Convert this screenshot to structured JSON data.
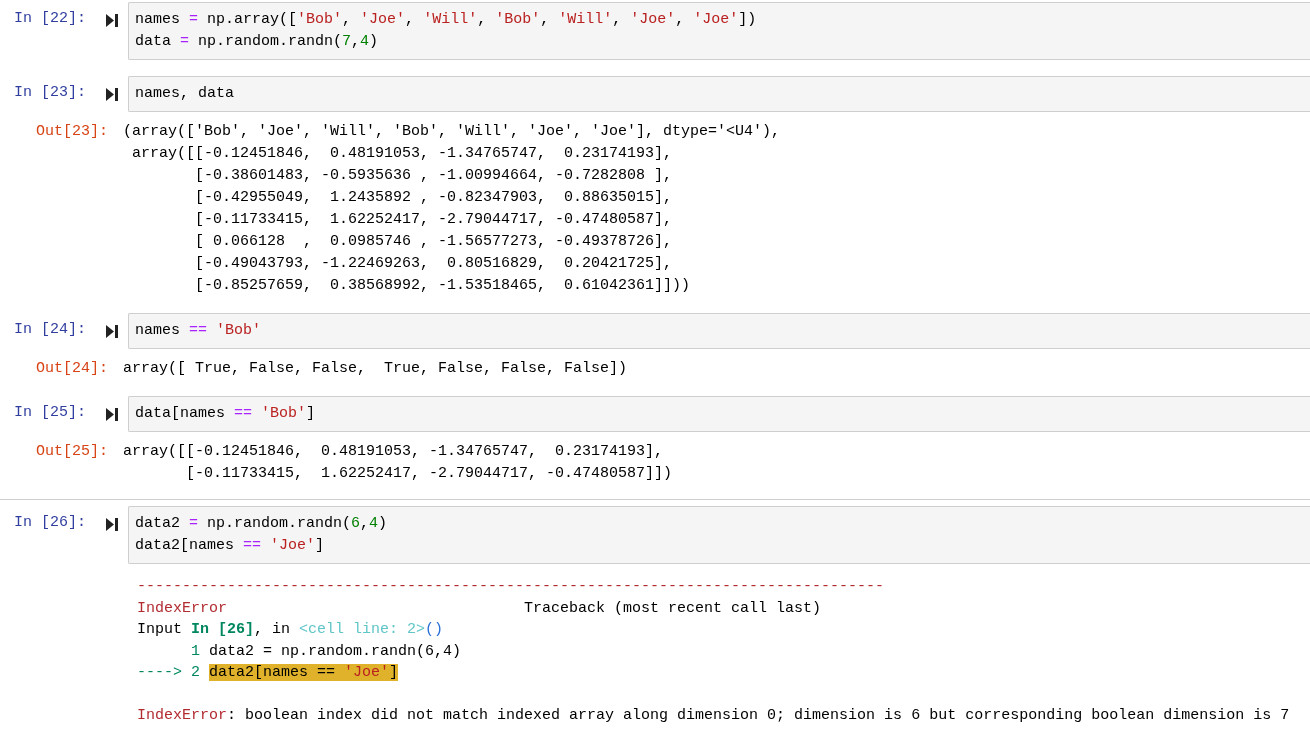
{
  "cells": [
    {
      "prompt": "In [22]:",
      "divider_above": false,
      "input": [
        [
          {
            "kind": "plain",
            "text": "names "
          },
          {
            "kind": "op",
            "text": "="
          },
          {
            "kind": "plain",
            "text": " np.array(["
          },
          {
            "kind": "str",
            "text": "'Bob'"
          },
          {
            "kind": "plain",
            "text": ", "
          },
          {
            "kind": "str",
            "text": "'Joe'"
          },
          {
            "kind": "plain",
            "text": ", "
          },
          {
            "kind": "str",
            "text": "'Will'"
          },
          {
            "kind": "plain",
            "text": ", "
          },
          {
            "kind": "str",
            "text": "'Bob'"
          },
          {
            "kind": "plain",
            "text": ", "
          },
          {
            "kind": "str",
            "text": "'Will'"
          },
          {
            "kind": "plain",
            "text": ", "
          },
          {
            "kind": "str",
            "text": "'Joe'"
          },
          {
            "kind": "plain",
            "text": ", "
          },
          {
            "kind": "str",
            "text": "'Joe'"
          },
          {
            "kind": "plain",
            "text": "])"
          }
        ],
        [
          {
            "kind": "plain",
            "text": "data "
          },
          {
            "kind": "op",
            "text": "="
          },
          {
            "kind": "plain",
            "text": " np.random.randn("
          },
          {
            "kind": "num",
            "text": "7"
          },
          {
            "kind": "plain",
            "text": ","
          },
          {
            "kind": "num",
            "text": "4"
          },
          {
            "kind": "plain",
            "text": ")"
          }
        ]
      ]
    },
    {
      "prompt": "In [23]:",
      "divider_above": false,
      "input": [
        [
          {
            "kind": "plain",
            "text": "names, data"
          }
        ]
      ],
      "output": {
        "kind": "text",
        "prompt": "Out[23]:",
        "lines": [
          "(array(['Bob', 'Joe', 'Will', 'Bob', 'Will', 'Joe', 'Joe'], dtype='<U4'),",
          " array([[-0.12451846,  0.48191053, -1.34765747,  0.23174193],",
          "        [-0.38601483, -0.5935636 , -1.00994664, -0.7282808 ],",
          "        [-0.42955049,  1.2435892 , -0.82347903,  0.88635015],",
          "        [-0.11733415,  1.62252417, -2.79044717, -0.47480587],",
          "        [ 0.066128  ,  0.0985746 , -1.56577273, -0.49378726],",
          "        [-0.49043793, -1.22469263,  0.80516829,  0.20421725],",
          "        [-0.85257659,  0.38568992, -1.53518465,  0.61042361]]))"
        ]
      }
    },
    {
      "prompt": "In [24]:",
      "divider_above": false,
      "input": [
        [
          {
            "kind": "plain",
            "text": "names"
          },
          {
            "kind": "op",
            "text": " == "
          },
          {
            "kind": "str",
            "text": "'Bob'"
          }
        ]
      ],
      "output": {
        "kind": "text",
        "prompt": "Out[24]:",
        "lines": [
          "array([ True, False, False,  True, False, False, False])"
        ]
      }
    },
    {
      "prompt": "In [25]:",
      "divider_above": false,
      "input": [
        [
          {
            "kind": "plain",
            "text": "data[names"
          },
          {
            "kind": "op",
            "text": " == "
          },
          {
            "kind": "str",
            "text": "'Bob'"
          },
          {
            "kind": "plain",
            "text": "]"
          }
        ]
      ],
      "output": {
        "kind": "text",
        "prompt": "Out[25]:",
        "lines": [
          "array([[-0.12451846,  0.48191053, -1.34765747,  0.23174193],",
          "       [-0.11733415,  1.62252417, -2.79044717, -0.47480587]])"
        ]
      }
    },
    {
      "prompt": "In [26]:",
      "divider_above": true,
      "input": [
        [
          {
            "kind": "plain",
            "text": "data2 "
          },
          {
            "kind": "op",
            "text": "="
          },
          {
            "kind": "plain",
            "text": " np.random.randn("
          },
          {
            "kind": "num",
            "text": "6"
          },
          {
            "kind": "plain",
            "text": ","
          },
          {
            "kind": "num",
            "text": "4"
          },
          {
            "kind": "plain",
            "text": ")"
          }
        ],
        [
          {
            "kind": "plain",
            "text": "data2[names"
          },
          {
            "kind": "op",
            "text": " == "
          },
          {
            "kind": "str",
            "text": "'Joe'"
          },
          {
            "kind": "plain",
            "text": "]"
          }
        ]
      ],
      "output": {
        "kind": "error",
        "traceback": [
          [
            {
              "kind": "err",
              "text": "-----------------------------------------------------------------------------------"
            }
          ],
          [
            {
              "kind": "err",
              "text": "IndexError"
            },
            {
              "kind": "plain",
              "text": "                                 Traceback (most recent call last)"
            }
          ],
          [
            {
              "kind": "plain",
              "text": "Input "
            },
            {
              "kind": "green",
              "text": "In [26]"
            },
            {
              "kind": "plain",
              "text": ", in "
            },
            {
              "kind": "cyan",
              "text": "<cell line: 2>"
            },
            {
              "kind": "blue",
              "text": "()"
            }
          ],
          [
            {
              "kind": "lineno",
              "text": "      1"
            },
            {
              "kind": "plain",
              "text": " data2 = np.random.randn(6,4)"
            }
          ],
          [
            {
              "kind": "lineno",
              "text": "----> 2 "
            },
            {
              "kind": "hl",
              "text": "data2[names == "
            },
            {
              "kind": "hlstr",
              "text": "'Joe'"
            },
            {
              "kind": "hl",
              "text": "]"
            }
          ]
        ],
        "message": [
          {
            "kind": "err",
            "text": "IndexError"
          },
          {
            "kind": "plain",
            "text": ": boolean index did not match indexed array along dimension 0; dimension is 6 but corresponding boolean dimension is 7"
          }
        ]
      }
    }
  ]
}
